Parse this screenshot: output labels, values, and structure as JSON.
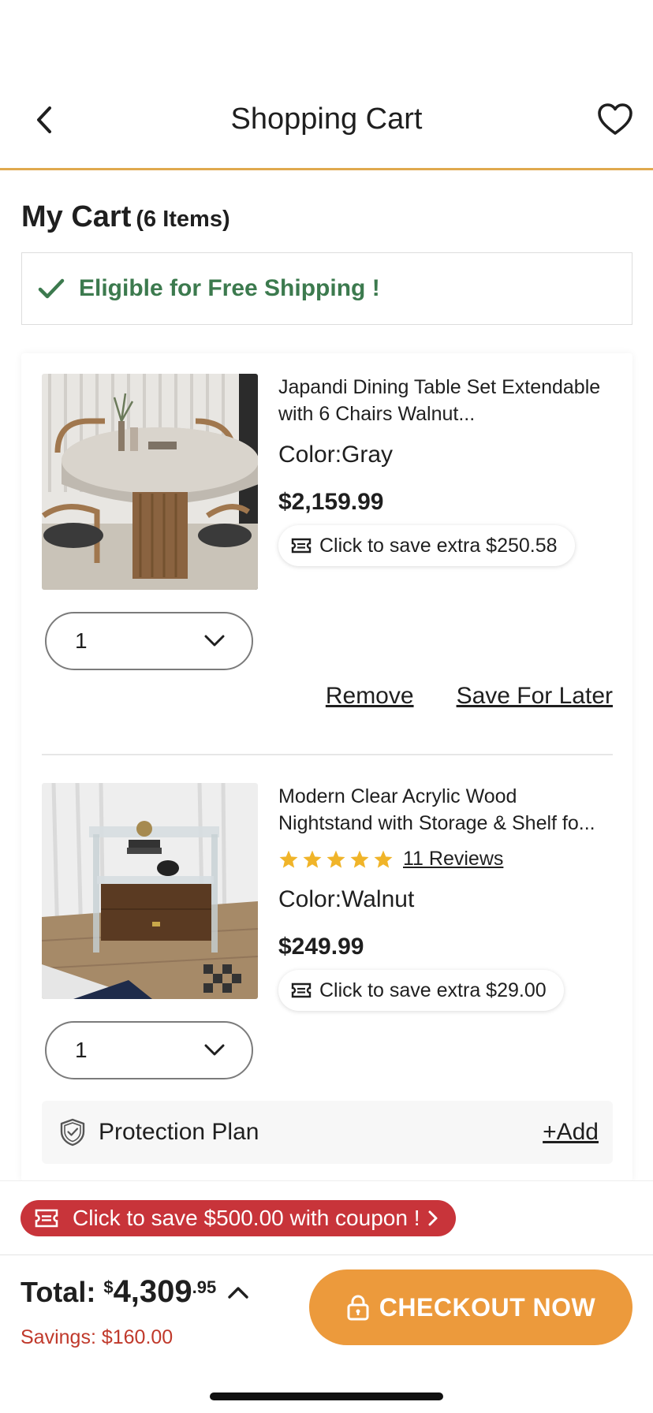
{
  "header": {
    "title": "Shopping Cart"
  },
  "cart": {
    "heading": "My Cart",
    "count_label": "(6 Items)",
    "free_shipping": "Eligible for Free Shipping !"
  },
  "items": [
    {
      "name": "Japandi Dining Table Set Extendable with 6 Chairs Walnut...",
      "color": "Color:Gray",
      "price": "$2,159.99",
      "save_extra": "Click to save extra $250.58",
      "qty": "1"
    },
    {
      "name": "Modern Clear Acrylic Wood Nightstand with Storage & Shelf fo...",
      "rating": 5,
      "reviews": "11 Reviews",
      "color": "Color:Walnut",
      "price": "$249.99",
      "save_extra": "Click to save extra $29.00",
      "qty": "1"
    }
  ],
  "actions": {
    "remove": "Remove",
    "save_for_later": "Save For Later"
  },
  "protection": {
    "label": "Protection Plan",
    "add": "+Add"
  },
  "coupon": {
    "text": "Click to save $500.00 with coupon !"
  },
  "footer": {
    "total_label": "Total:",
    "currency": "$",
    "total_dollars": "4,309",
    "total_cents": ".95",
    "savings": "Savings: $160.00",
    "checkout": "CHECKOUT NOW"
  },
  "colors": {
    "accent": "#ec9a3c",
    "header_border": "#e0a94e",
    "free_shipping_green": "#3c7a4e",
    "coupon_red": "#c8343a",
    "savings_red": "#c0392b",
    "star": "#f0b429"
  }
}
